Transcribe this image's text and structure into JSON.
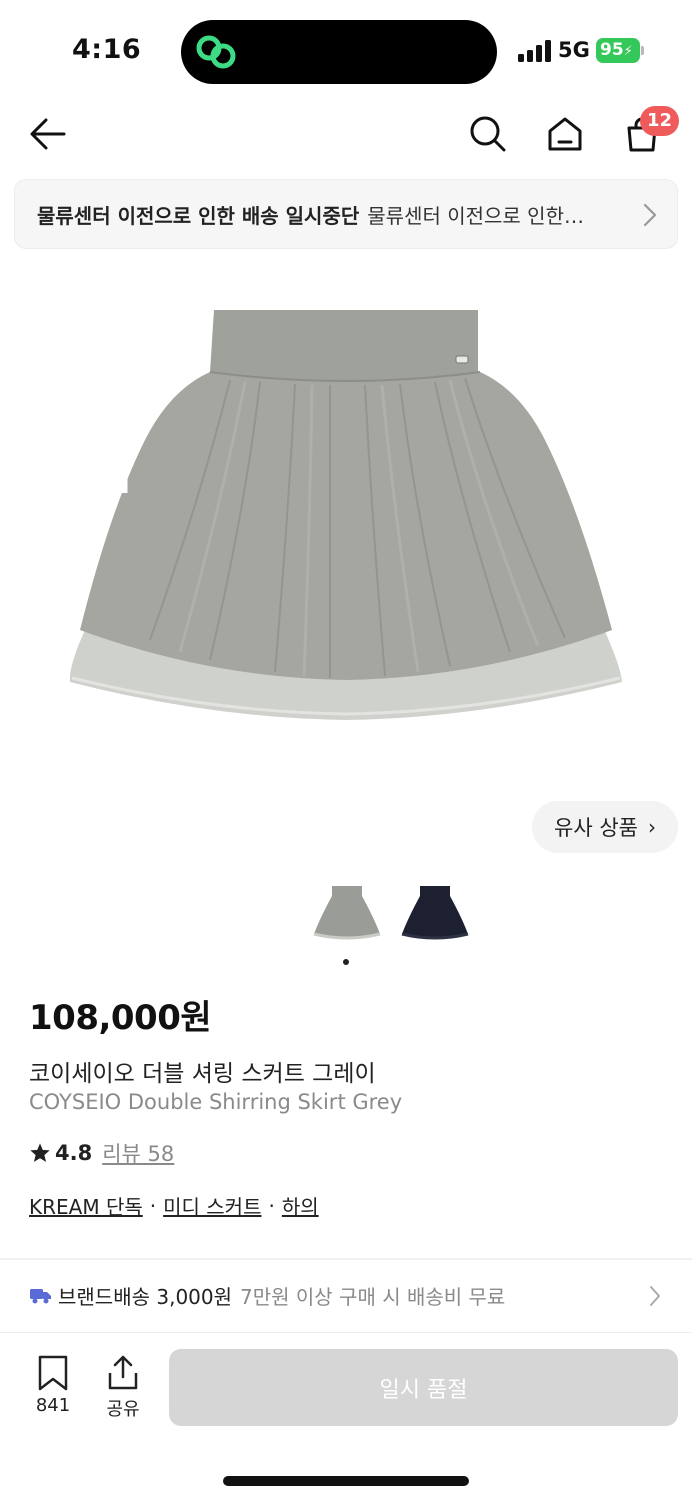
{
  "status_bar": {
    "time": "4:16",
    "network": "5G",
    "battery": "95"
  },
  "nav": {
    "cart_count": "12"
  },
  "notice": {
    "title": "물류센터 이전으로 인한 배송 일시중단",
    "text": "물류센터 이전으로 인한…"
  },
  "gallery": {
    "similar_label": "유사 상품",
    "thumbnails": [
      {
        "color_name": "grey",
        "color": "#9a9c97"
      },
      {
        "color_name": "navy",
        "color": "#1c2030"
      }
    ]
  },
  "product": {
    "price": "108,000원",
    "name_ko": "코이세이오 더블 셔링 스커트 그레이",
    "name_en": "COYSEIO Double Shirring Skirt Grey",
    "rating": "4.8",
    "reviews_label": "리뷰 58",
    "tags": [
      "KREAM 단독",
      "미디 스커트",
      "하의"
    ]
  },
  "shipping": {
    "label": "브랜드배송 3,000원",
    "detail": "7만원 이상 구매 시 배송비 무료"
  },
  "bottom_bar": {
    "bookmark_count": "841",
    "share_label": "공유",
    "cta_label": "일시 품절"
  },
  "colors": {
    "accent_red": "#ef5a5a",
    "battery_green": "#34c759",
    "shipping_icon": "#5b6bd6",
    "cta_disabled": "#d6d6d6"
  }
}
